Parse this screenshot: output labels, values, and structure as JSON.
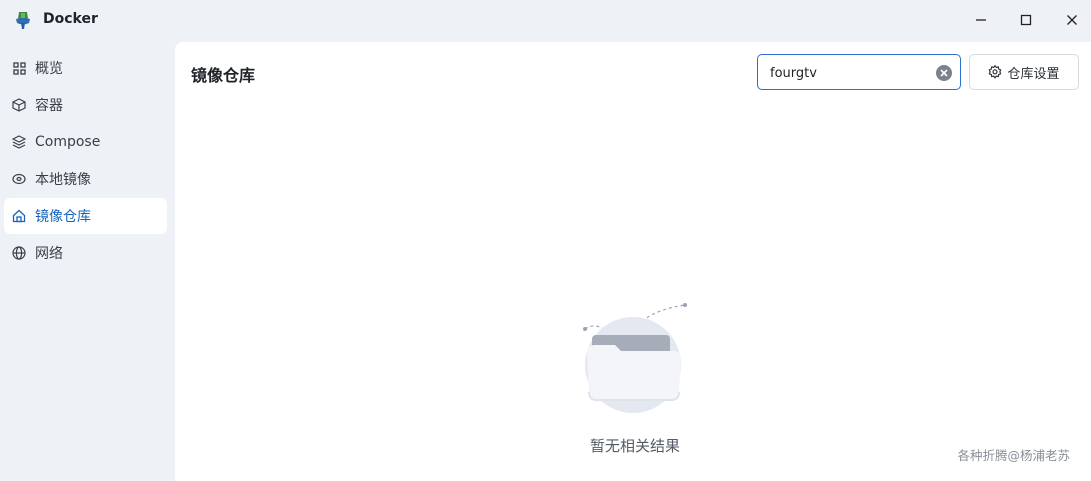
{
  "app": {
    "title": "Docker"
  },
  "sidebar": {
    "items": [
      {
        "label": "概览",
        "icon": "grid-icon"
      },
      {
        "label": "容器",
        "icon": "cube-icon"
      },
      {
        "label": "Compose",
        "icon": "layers-icon"
      },
      {
        "label": "本地镜像",
        "icon": "disk-icon"
      },
      {
        "label": "镜像仓库",
        "icon": "home-icon",
        "active": true
      },
      {
        "label": "网络",
        "icon": "globe-icon"
      }
    ]
  },
  "main": {
    "title": "镜像仓库",
    "search": {
      "value": "fourgtv"
    },
    "settings_label": "仓库设置",
    "empty_text": "暂无相关结果"
  },
  "watermark": "各种折腾@杨浦老苏",
  "colors": {
    "accent": "#2d6fd1",
    "active_text": "#1565c0",
    "sidebar_bg": "#eef1f6"
  }
}
